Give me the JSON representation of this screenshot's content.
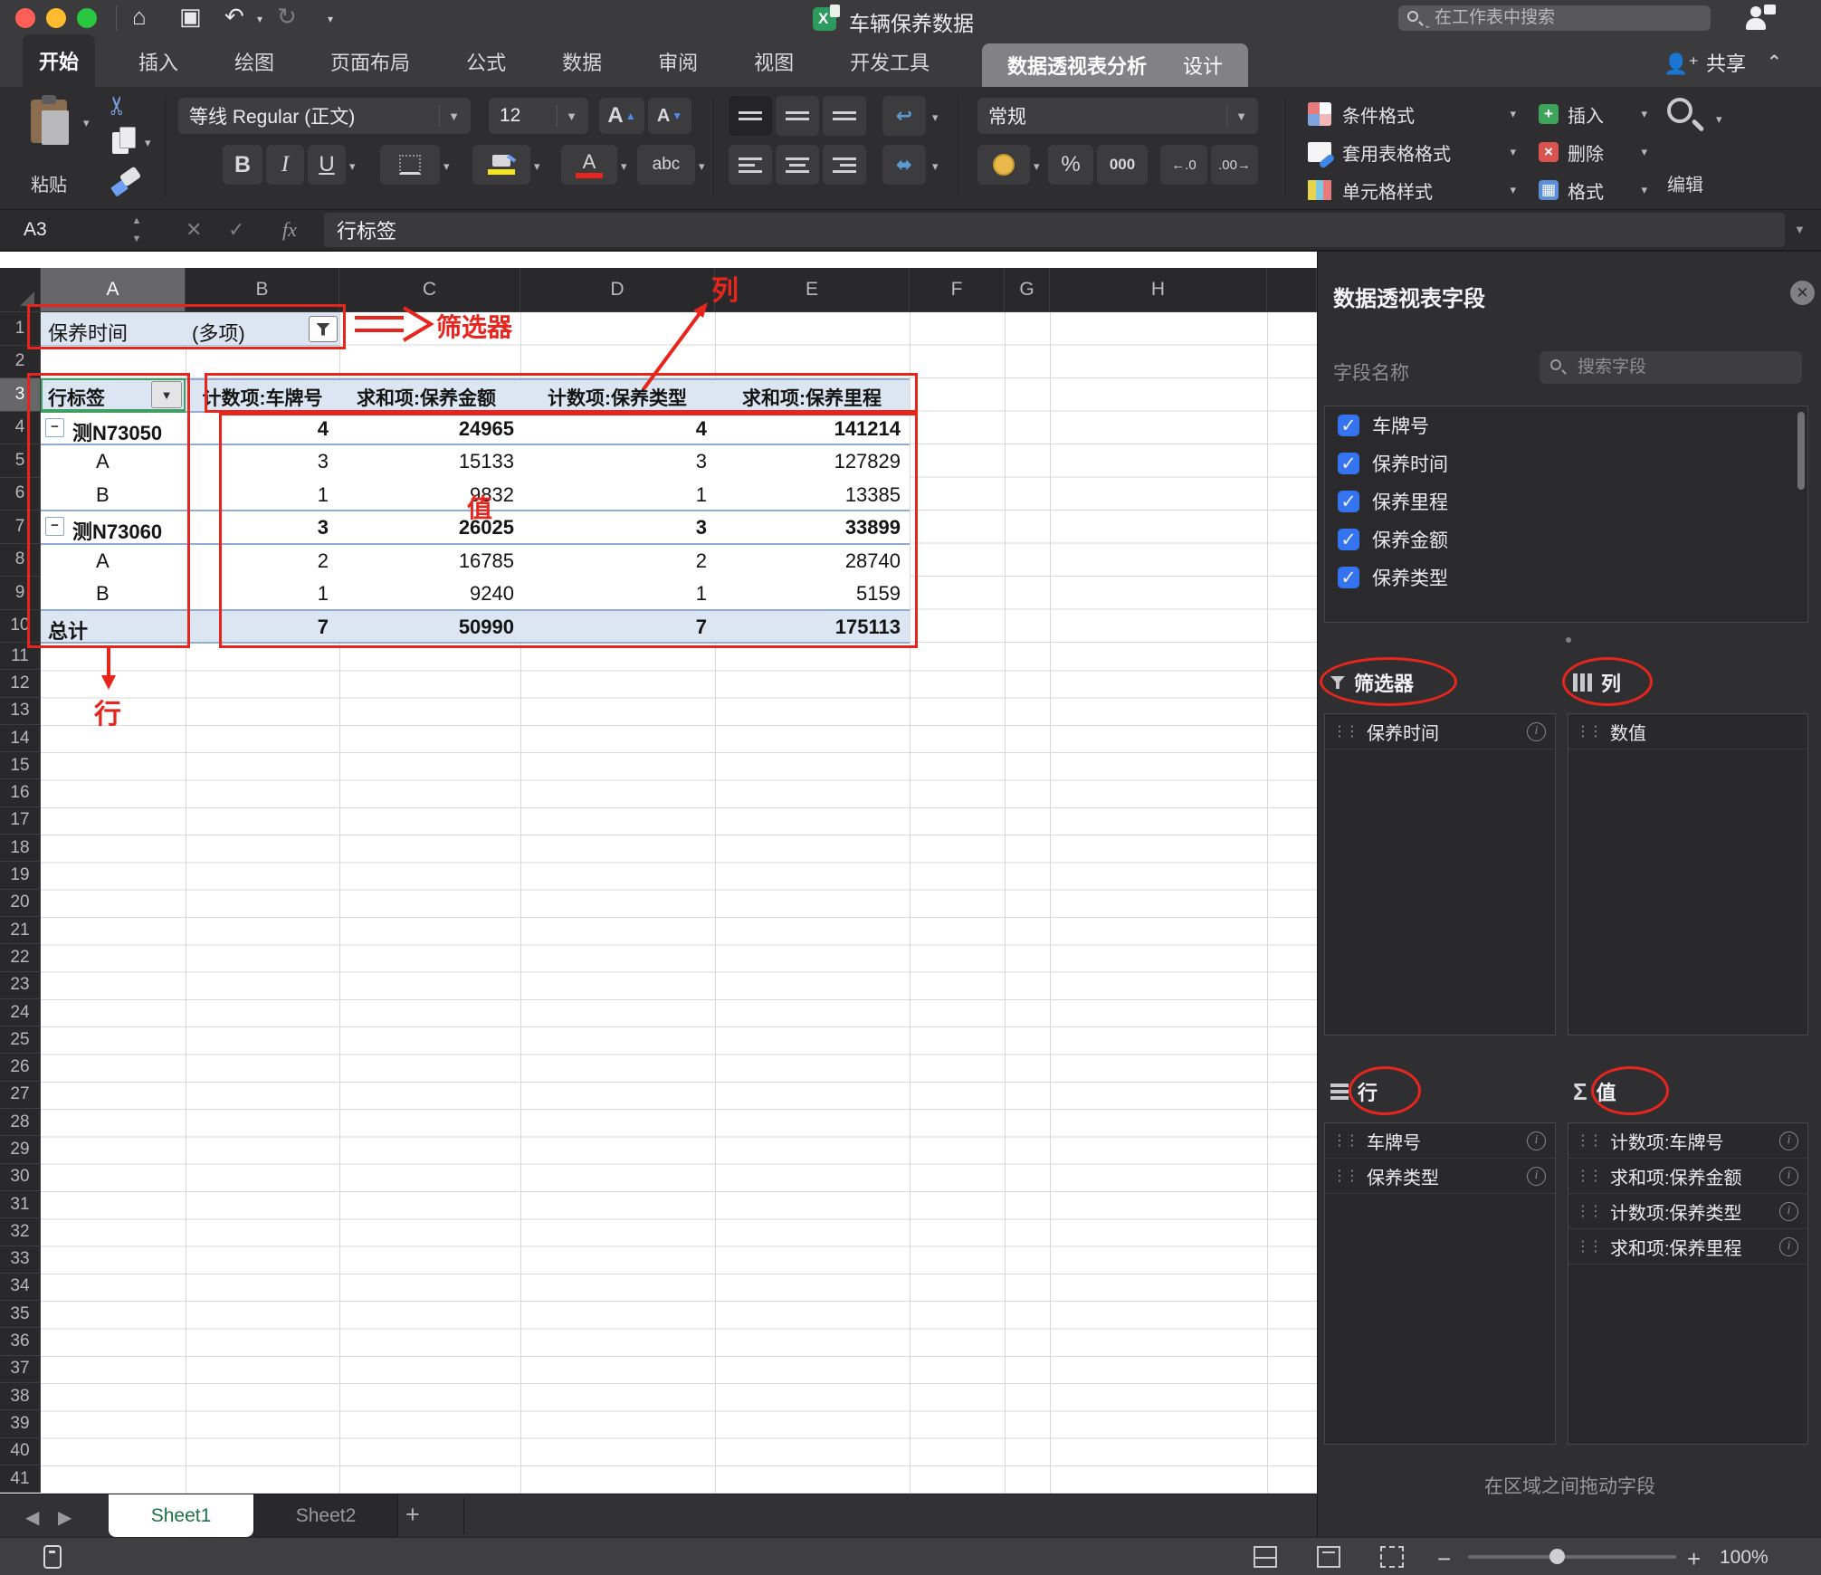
{
  "titlebar": {
    "doc_title": "车辆保养数据",
    "search_placeholder": "在工作表中搜索"
  },
  "tabs": {
    "items": [
      "开始",
      "插入",
      "绘图",
      "页面布局",
      "公式",
      "数据",
      "审阅",
      "视图",
      "开发工具"
    ],
    "active": "开始",
    "contextual": [
      "数据透视表分析",
      "设计"
    ],
    "active_contextual": "数据透视表分析",
    "share_label": "共享"
  },
  "ribbon": {
    "paste_label": "粘贴",
    "font_name": "等线 Regular (正文)",
    "font_size": "12",
    "bold": "B",
    "italic": "I",
    "underline": "U",
    "strike_label": "abc",
    "number_format": "常规",
    "percent": "%",
    "thousands": "000",
    "dec_left": "←.0",
    "dec_right": ".00→",
    "styles": {
      "conditional": "条件格式",
      "format_table": "套用表格格式",
      "cell_styles": "单元格样式"
    },
    "cells": {
      "insert": "插入",
      "delete": "删除",
      "format": "格式"
    },
    "edit_label": "编辑"
  },
  "formula_bar": {
    "cell_ref": "A3",
    "fx": "fx",
    "content": "行标签"
  },
  "grid": {
    "column_letters": [
      "A",
      "B",
      "C",
      "D",
      "E",
      "F",
      "G",
      "H",
      ""
    ],
    "row_count": 41,
    "highlight_col": "A",
    "highlight_row": 3
  },
  "pivot": {
    "filter_cell": {
      "label": "保养时间",
      "value": "(多项)"
    },
    "header_row": {
      "row_label": "行标签",
      "cols": [
        "计数项:车牌号",
        "求和项:保养金额",
        "计数项:保养类型",
        "求和项:保养里程"
      ]
    },
    "rows": [
      {
        "label": "测N73050",
        "type": "group",
        "v": [
          "4",
          "24965",
          "4",
          "141214"
        ]
      },
      {
        "label": "A",
        "type": "child",
        "v": [
          "3",
          "15133",
          "3",
          "127829"
        ]
      },
      {
        "label": "B",
        "type": "child",
        "v": [
          "1",
          "9832",
          "1",
          "13385"
        ]
      },
      {
        "label": "测N73060",
        "type": "group",
        "v": [
          "3",
          "26025",
          "3",
          "33899"
        ]
      },
      {
        "label": "A",
        "type": "child",
        "v": [
          "2",
          "16785",
          "2",
          "28740"
        ]
      },
      {
        "label": "B",
        "type": "child",
        "v": [
          "1",
          "9240",
          "1",
          "5159"
        ]
      },
      {
        "label": "总计",
        "type": "total",
        "v": [
          "7",
          "50990",
          "7",
          "175113"
        ]
      }
    ]
  },
  "annotations": {
    "filter_label": "筛选器",
    "column_label": "列",
    "row_label": "行",
    "value_label": "值",
    "accent": "#e8251d"
  },
  "panel": {
    "title": "数据透视表字段",
    "field_name_label": "字段名称",
    "search_placeholder": "搜索字段",
    "fields": [
      "车牌号",
      "保养时间",
      "保养里程",
      "保养金额",
      "保养类型"
    ],
    "areas": {
      "filters_label": "筛选器",
      "columns_label": "列",
      "rows_label": "行",
      "values_label": "值",
      "filters": [
        "保养时间"
      ],
      "columns": [
        "数值"
      ],
      "rows": [
        "车牌号",
        "保养类型"
      ],
      "values": [
        "计数项:车牌号",
        "求和项:保养金额",
        "计数项:保养类型",
        "求和项:保养里程"
      ]
    },
    "hint": "在区域之间拖动字段"
  },
  "sheetbar": {
    "tabs": [
      "Sheet1",
      "Sheet2"
    ],
    "active": "Sheet1",
    "add": "+"
  },
  "statusbar": {
    "zoom": "100%"
  },
  "colors": {
    "annotation_red": "#e8251d",
    "pivot_blue": "#dce6f2",
    "excel_green": "#1e7145",
    "checkbox_blue": "#3574f0"
  }
}
